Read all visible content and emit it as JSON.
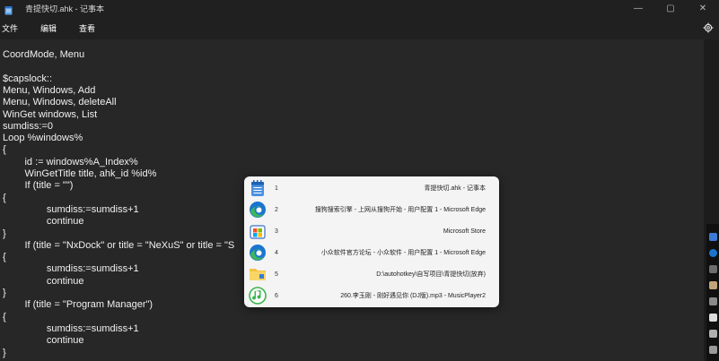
{
  "window": {
    "title": "青提快切.ahk - 记事本",
    "controls": {
      "minimize": "—",
      "maximize": "▢",
      "close": "✕"
    }
  },
  "menu": {
    "items": [
      "文件",
      "编辑",
      "查看"
    ]
  },
  "editor": {
    "lines": [
      "CoordMode, Menu",
      "",
      "$capslock::",
      "Menu, Windows, Add",
      "Menu, Windows, deleteAll",
      "WinGet windows, List",
      "sumdiss:=0",
      "Loop %windows%",
      "{",
      "        id := windows%A_Index%",
      "        WinGetTitle title, ahk_id %id%",
      "        If (title = \"\")",
      "{",
      "                sumdiss:=sumdiss+1",
      "                continue",
      "}",
      "        If (title = \"NxDock\" or title = \"NeXuS\" or title = \"S",
      "{",
      "                sumdiss:=sumdiss+1",
      "                continue",
      "}",
      "        If (title = \"Program Manager\")",
      "{",
      "                sumdiss:=sumdiss+1",
      "                continue",
      "}"
    ]
  },
  "switcher": {
    "items": [
      {
        "num": "1",
        "title": "青提快切.ahk - 记事本",
        "icon": "notepad-icon"
      },
      {
        "num": "2",
        "title": "搜狗搜索引擎 - 上网从搜狗开始 - 用户配置 1 - Microsoft Edge",
        "icon": "edge-icon"
      },
      {
        "num": "3",
        "title": "Microsoft Store",
        "icon": "store-icon"
      },
      {
        "num": "4",
        "title": "小众软件官方论坛 - 小众软件 - 用户配置 1 - Microsoft Edge",
        "icon": "edge-icon"
      },
      {
        "num": "5",
        "title": "D:\\autohotkey\\自写项目\\青提快切(放弃)",
        "icon": "folder-icon"
      },
      {
        "num": "6",
        "title": "260.李玉刚 - 刚好遇见你 (DJ版).mp3 - MusicPlayer2",
        "icon": "music-icon"
      }
    ]
  },
  "colors": {
    "background": "#202020",
    "editor": "#272727",
    "popup": "#f4f4f4",
    "edge_blue": "#1b75d0",
    "edge_green": "#3fb65a",
    "folder_yellow": "#f3c143",
    "music_green": "#3bb54a"
  }
}
